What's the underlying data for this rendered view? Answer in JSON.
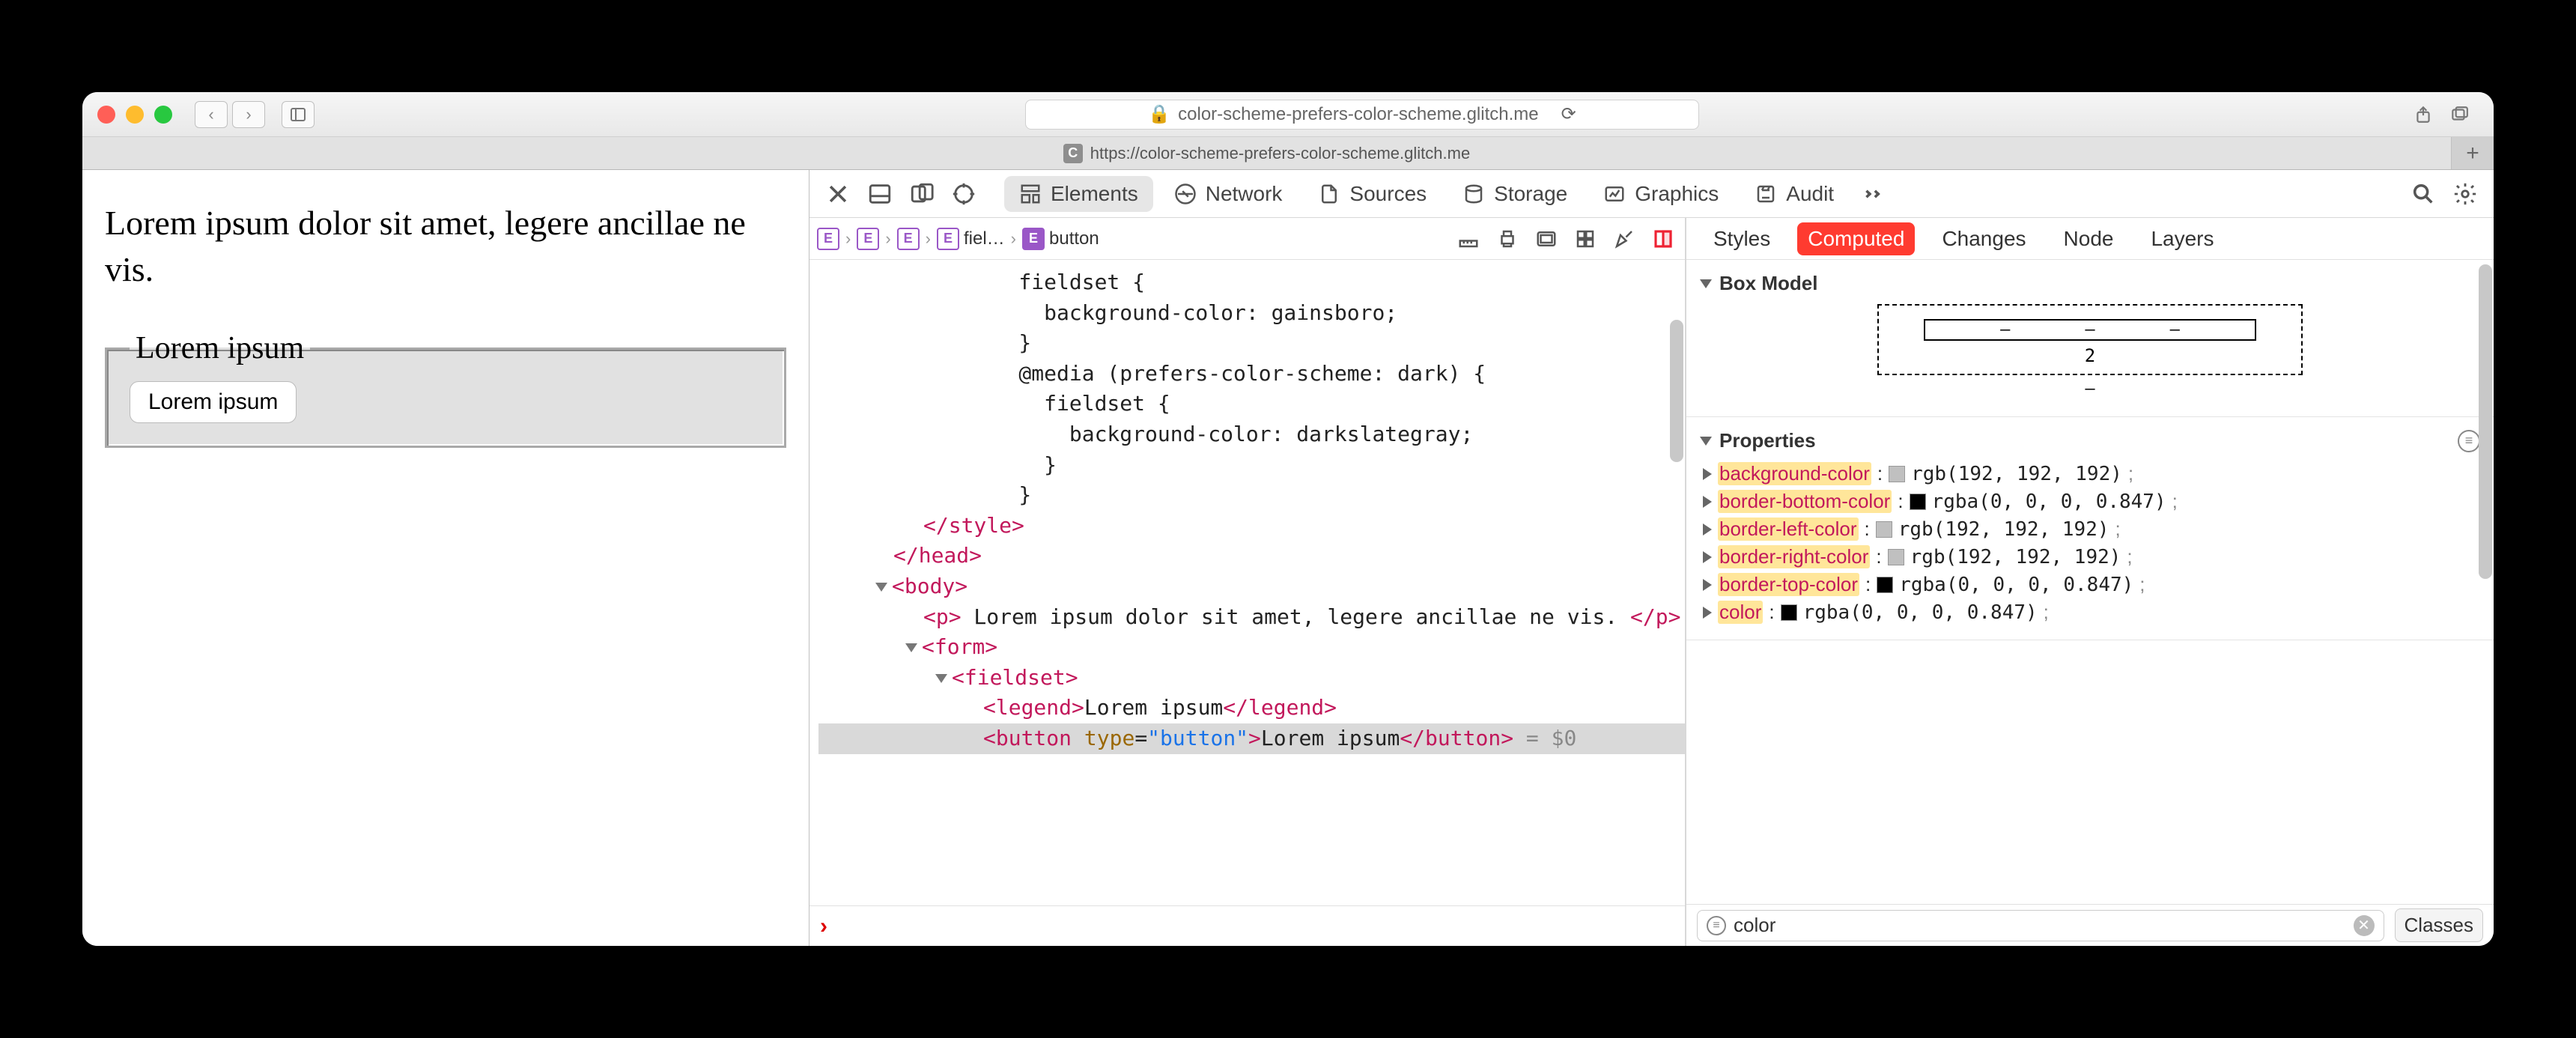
{
  "browser": {
    "url": "color-scheme-prefers-color-scheme.glitch.me",
    "lock": "🔒",
    "tab_url": "https://color-scheme-prefers-color-scheme.glitch.me",
    "favicon_letter": "C"
  },
  "page": {
    "paragraph": "Lorem ipsum dolor sit amet, legere ancillae ne vis.",
    "legend": "Lorem ipsum",
    "button": "Lorem ipsum"
  },
  "devtools": {
    "tabs": {
      "elements": "Elements",
      "network": "Network",
      "sources": "Sources",
      "storage": "Storage",
      "graphics": "Graphics",
      "audit": "Audit"
    },
    "breadcrumb": {
      "fiel": "fiel…",
      "button": "button"
    },
    "dom": {
      "l1": "    fieldset {",
      "l2": "      background-color: gainsboro;",
      "l3": "    }",
      "l4": "    @media (prefers-color-scheme: dark) {",
      "l5": "      fieldset {",
      "l6": "        background-color: darkslategray;",
      "l7": "      }",
      "l8": "    }",
      "style_close": "</style>",
      "head_close": "</head>",
      "body_open": "<body>",
      "p_open": "<p>",
      "p_text": " Lorem ipsum dolor sit amet, legere ancillae ne vis. ",
      "p_close": "</p>",
      "form_open": "<form>",
      "fs_open": "<fieldset>",
      "lg_open": "<legend>",
      "lg_text": "Lorem ipsum",
      "lg_close": "</legend>",
      "btn_open": "<button",
      "btn_attr": " type",
      "btn_eq": "=",
      "btn_val": "\"button\"",
      "btn_gt": ">",
      "btn_text": "Lorem ipsum",
      "btn_close": "</button>",
      "eq0": " = $0"
    },
    "side": {
      "tabs": {
        "styles": "Styles",
        "computed": "Computed",
        "changes": "Changes",
        "node": "Node",
        "layers": "Layers"
      },
      "boxmodel_title": "Box Model",
      "boxmodel_center": "2",
      "dash": "–",
      "properties_title": "Properties",
      "props": [
        {
          "name": "background-color",
          "swatch": "#c0c0c0",
          "value": "rgb(192, 192, 192)"
        },
        {
          "name": "border-bottom-color",
          "swatch": "#000000",
          "value": "rgba(0, 0, 0, 0.847)"
        },
        {
          "name": "border-left-color",
          "swatch": "#c0c0c0",
          "value": "rgb(192, 192, 192)"
        },
        {
          "name": "border-right-color",
          "swatch": "#c0c0c0",
          "value": "rgb(192, 192, 192)"
        },
        {
          "name": "border-top-color",
          "swatch": "#000000",
          "value": "rgba(0, 0, 0, 0.847)"
        },
        {
          "name": "color",
          "swatch": "#000000",
          "value": "rgba(0, 0, 0, 0.847)"
        }
      ],
      "filter_value": "color",
      "classes_btn": "Classes"
    }
  }
}
